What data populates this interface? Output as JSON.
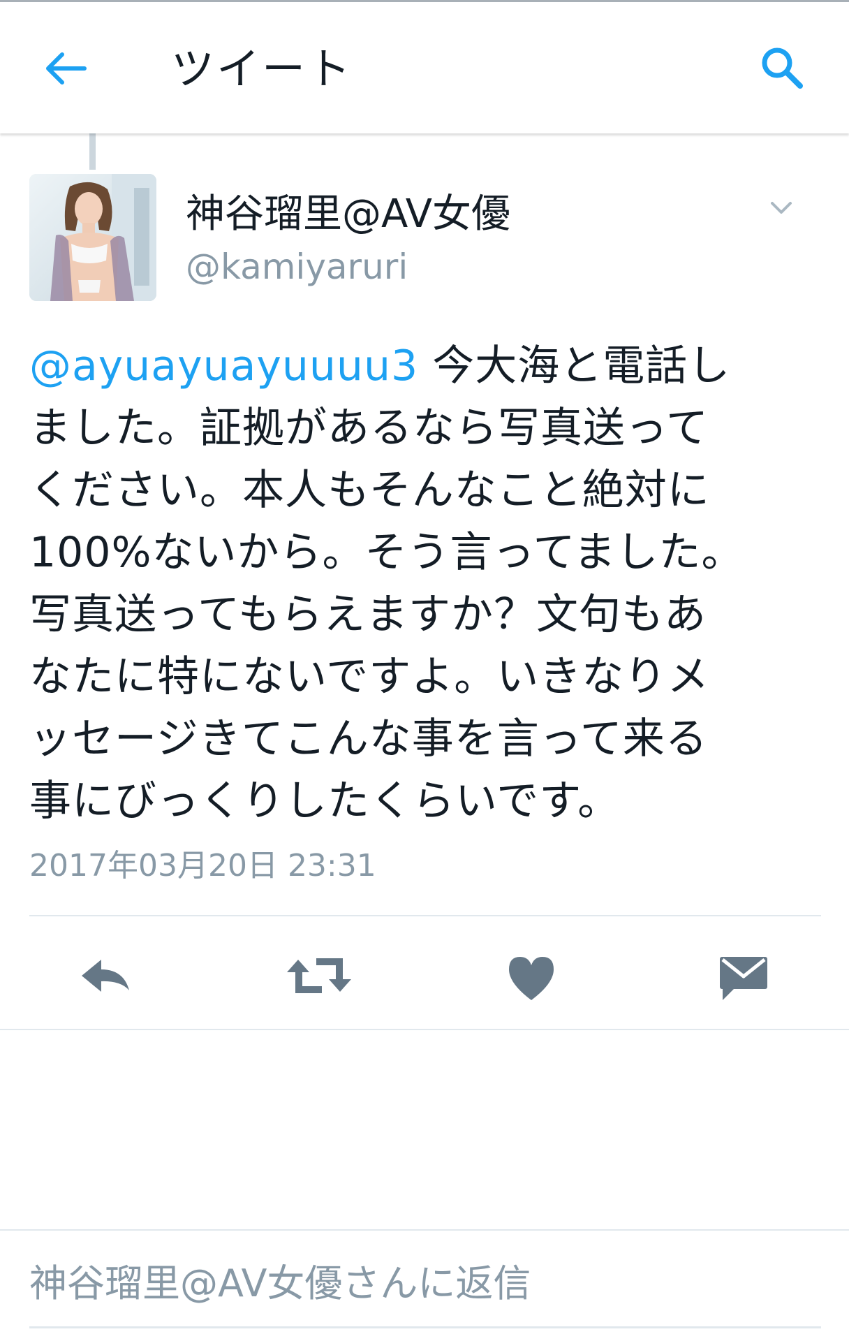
{
  "app_bar": {
    "title": "ツイート",
    "back_icon": "arrow-left-icon",
    "search_icon": "search-icon",
    "accent_color": "#1da1f2"
  },
  "tweet": {
    "author": {
      "display_name": "神谷瑠里@AV女優",
      "handle": "@kamiyaruri",
      "avatar": "avatar-photo"
    },
    "menu_icon": "chevron-down-icon",
    "lines": [
      {
        "mention": "@ayuayuayuuuu3",
        "text": " 今大海と電話し"
      },
      {
        "mention": "",
        "text": "ました。証拠があるなら写真送って"
      },
      {
        "mention": "",
        "text": "ください。本人もそんなこと絶対に"
      },
      {
        "mention": "",
        "text": "100%ないから。そう言ってました。"
      },
      {
        "mention": "",
        "text": "写真送ってもらえますか？文句もあ"
      },
      {
        "mention": "",
        "text": "なたに特にないですよ。いきなりメ"
      },
      {
        "mention": "",
        "text": "ッセージきてこんな事を言って来る"
      },
      {
        "mention": "",
        "text": "事にびっくりしたくらいです。"
      }
    ],
    "timestamp": "2017年03月20日 23:31"
  },
  "actions": [
    {
      "name": "reply",
      "icon": "reply-icon"
    },
    {
      "name": "retweet",
      "icon": "retweet-icon"
    },
    {
      "name": "like",
      "icon": "heart-icon"
    },
    {
      "name": "direct-message",
      "icon": "envelope-icon"
    }
  ],
  "reply_box": {
    "placeholder": "神谷瑠里@AV女優さんに返信"
  },
  "colors": {
    "text": "#141d26",
    "secondary": "#8899a6",
    "action_icon": "#657786",
    "divider": "#e1e8ed"
  }
}
